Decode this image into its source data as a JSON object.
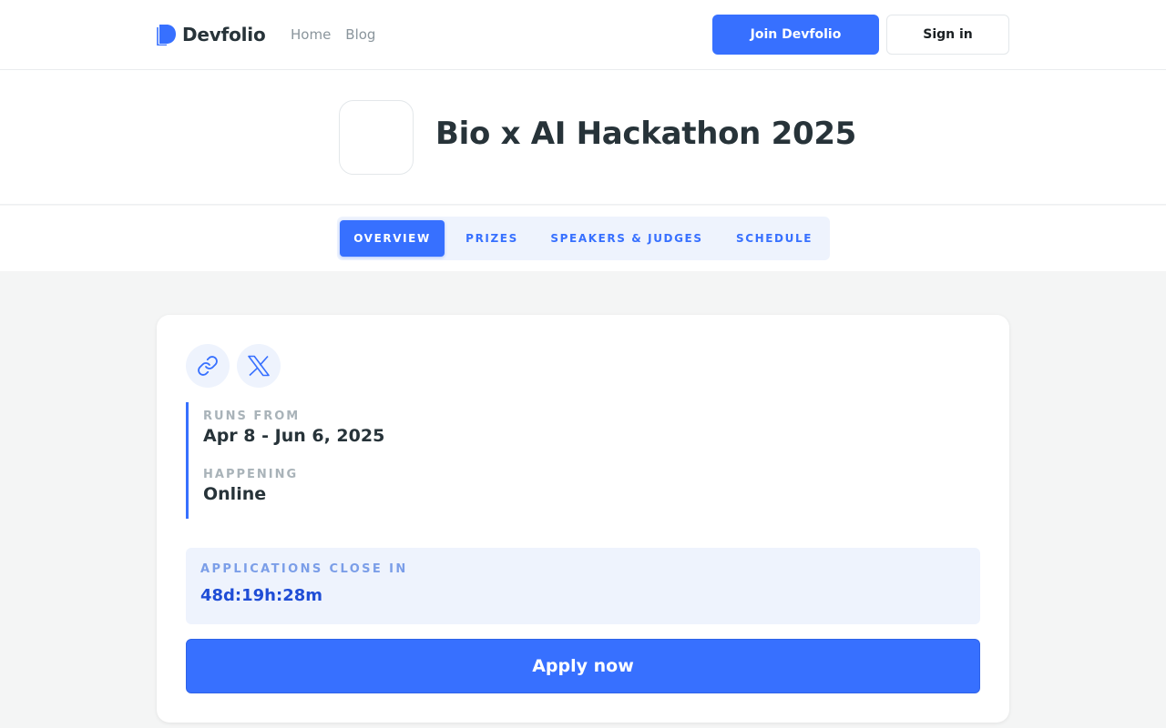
{
  "brand": {
    "name": "Devfolio",
    "icon": "devfolio-logo-icon",
    "color": "#3770ff"
  },
  "nav": {
    "links": [
      "Home",
      "Blog"
    ],
    "join_label": "Join Devfolio",
    "signin_label": "Sign in"
  },
  "hackathon": {
    "title": "Bio x AI Hackathon 2025"
  },
  "tabs": [
    {
      "label": "OVERVIEW",
      "active": true
    },
    {
      "label": "PRIZES",
      "active": false
    },
    {
      "label": "SPEAKERS & JUDGES",
      "active": false
    },
    {
      "label": "SCHEDULE",
      "active": false
    }
  ],
  "overview": {
    "social_icons": [
      "link-icon",
      "x-twitter-icon"
    ],
    "runs_from_label": "RUNS FROM",
    "runs_from_value": "Apr 8 - Jun 6, 2025",
    "happening_label": "HAPPENING",
    "happening_value": "Online",
    "countdown_label": "APPLICATIONS CLOSE IN",
    "countdown_value": "48d:19h:28m",
    "apply_label": "Apply now"
  }
}
